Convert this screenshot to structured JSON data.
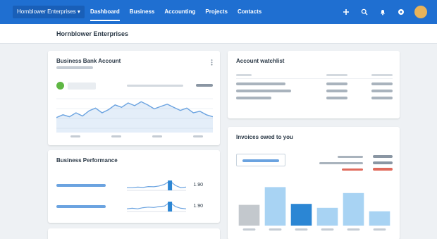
{
  "nav": {
    "org_label": "Hornblower Enterprises ▾",
    "items": [
      {
        "label": "Dashboard",
        "active": true
      },
      {
        "label": "Business"
      },
      {
        "label": "Accounting"
      },
      {
        "label": "Projects"
      },
      {
        "label": "Contacts"
      }
    ],
    "icons": [
      "plus-icon",
      "search-icon",
      "bell-icon",
      "help-icon"
    ],
    "accent": "#1f6fd1"
  },
  "page": {
    "title": "Hornblower Enterprises"
  },
  "bank_card": {
    "title": "Business Bank Account",
    "balance_series": [
      0.62,
      0.55,
      0.6,
      0.5,
      0.58,
      0.45,
      0.38,
      0.5,
      0.42,
      0.3,
      0.36,
      0.25,
      0.32,
      0.22,
      0.3,
      0.4,
      0.34,
      0.28,
      0.36,
      0.44,
      0.38,
      0.5,
      0.46,
      0.55,
      0.6
    ],
    "line_color": "#6ba3e0",
    "status_color": "#5fb744"
  },
  "performance_card": {
    "title": "Business Performance",
    "rows": [
      {
        "value": "1.90",
        "spark": [
          0.3,
          0.3,
          0.35,
          0.32,
          0.4,
          0.38,
          0.45,
          0.6,
          0.9,
          0.5,
          0.3,
          0.35
        ]
      },
      {
        "value": "1.90",
        "spark": [
          0.3,
          0.35,
          0.3,
          0.4,
          0.45,
          0.42,
          0.5,
          0.55,
          0.9,
          0.5,
          0.35,
          0.3
        ]
      }
    ]
  },
  "watchlist_card": {
    "title": "Account watchlist",
    "row_count": 3
  },
  "invoices_card": {
    "title": "Invoices owed to you",
    "bar_levels": [
      0.42,
      0.78,
      0.44,
      0.36,
      0.66,
      0.29
    ],
    "bar_colors": [
      "#c3c8cd",
      "#a8d3f3",
      "#2b86d4",
      "#a8d3f3",
      "#a8d3f3",
      "#a8d3f3"
    ],
    "overdue_color": "#e06a5c"
  }
}
